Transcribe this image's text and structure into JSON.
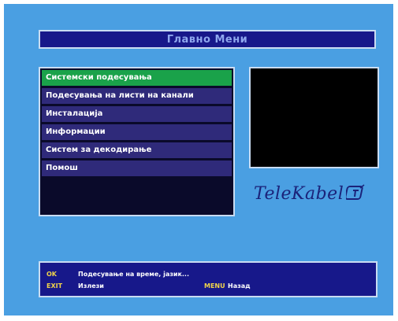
{
  "header": {
    "title": "Главно Мени"
  },
  "menu": {
    "items": [
      {
        "label": "Системски подесувања",
        "selected": true
      },
      {
        "label": "Подесувања на листи на канали",
        "selected": false
      },
      {
        "label": "Инсталација",
        "selected": false
      },
      {
        "label": "Информации",
        "selected": false
      },
      {
        "label": "Систем за декодирање",
        "selected": false
      },
      {
        "label": "Помош",
        "selected": false
      }
    ]
  },
  "logo": {
    "text": "TeleKabel",
    "icon": "telekabel-logo-mark"
  },
  "help": {
    "ok_key": "OK",
    "ok_text": "Подесување на време, јазик...",
    "exit_key": "EXIT",
    "exit_text": "Излези",
    "menu_key": "MENU",
    "menu_text": "Назад"
  },
  "colors": {
    "background": "#4a9fe2",
    "panel_dark": "#17188a",
    "selected_item": "#1aa24a",
    "item": "#2f2a7a",
    "key_color": "#f0d34a"
  }
}
